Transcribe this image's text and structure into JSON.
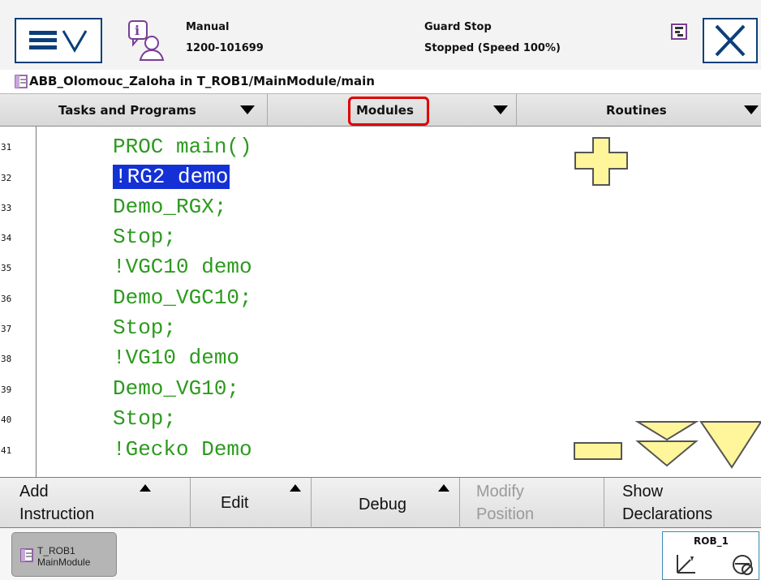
{
  "status": {
    "mode": "Manual",
    "controller_id": "1200-101699",
    "state": "Guard Stop",
    "run_state": "Stopped (Speed 100%)"
  },
  "path": {
    "text": "ABB_Olomouc_Zaloha in T_ROB1/MainModule/main"
  },
  "tabs": [
    {
      "label": "Tasks and Programs"
    },
    {
      "label": "Modules"
    },
    {
      "label": "Routines"
    }
  ],
  "code": {
    "lines": [
      {
        "no": "31",
        "text": "PROC main()"
      },
      {
        "no": "32",
        "text": "!RG2 demo"
      },
      {
        "no": "33",
        "text": "Demo_RGX;"
      },
      {
        "no": "34",
        "text": "Stop;"
      },
      {
        "no": "35",
        "text": "!VGC10 demo"
      },
      {
        "no": "36",
        "text": "Demo_VGC10;"
      },
      {
        "no": "37",
        "text": "Stop;"
      },
      {
        "no": "38",
        "text": "!VG10 demo"
      },
      {
        "no": "39",
        "text": "Demo_VG10;"
      },
      {
        "no": "40",
        "text": "Stop;"
      },
      {
        "no": "41",
        "text": "!Gecko Demo"
      }
    ],
    "selected_line": "32"
  },
  "commands": {
    "add_instruction_line1": "Add",
    "add_instruction_line2": "Instruction",
    "edit": "Edit",
    "debug": "Debug",
    "modify_position_line1": "Modify",
    "modify_position_line2": "Position",
    "show_declarations_line1": "Show",
    "show_declarations_line2": "Declarations"
  },
  "taskbar": {
    "program_line1": "T_ROB1",
    "program_line2": "MainModule",
    "mechanical_unit": "ROB_1"
  },
  "colors": {
    "code_green": "#2c9a1e",
    "selection_blue": "#1431d6",
    "highlight_red": "#e00000",
    "zoom_yellow": "#fff59a"
  }
}
